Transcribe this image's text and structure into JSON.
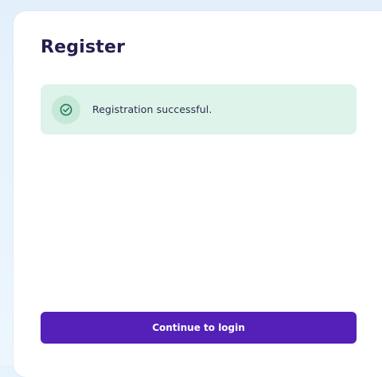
{
  "page": {
    "title": "Register"
  },
  "alert": {
    "message": "Registration successful.",
    "icon": "check-circle-icon",
    "status": "success",
    "colors": {
      "background": "#def3ea",
      "icon_background": "#c6e8d9",
      "icon_color": "#1e7a4d"
    }
  },
  "actions": {
    "continue_label": "Continue to login",
    "button_color": "#5320b8"
  },
  "colors": {
    "title": "#23204f",
    "page_background": "#e6f2fc"
  }
}
